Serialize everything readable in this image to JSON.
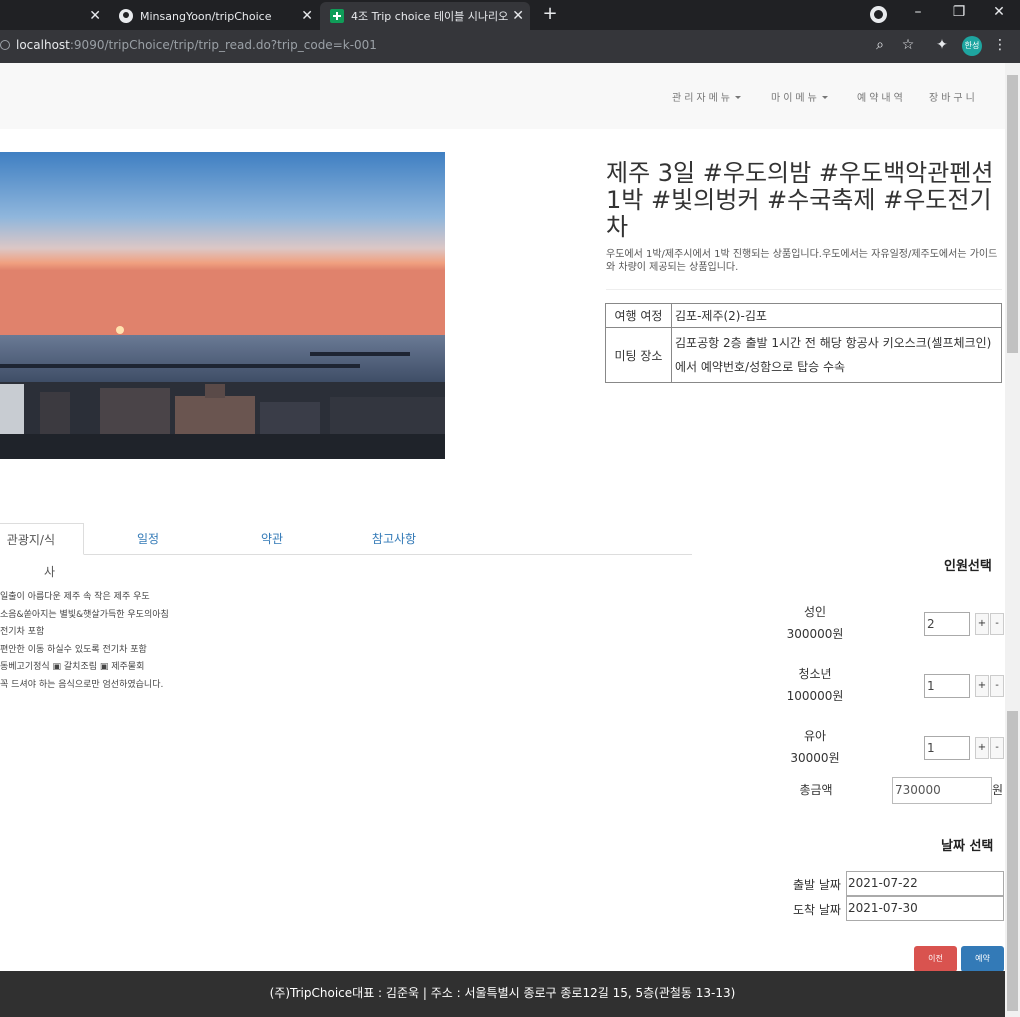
{
  "browser": {
    "tabs": [
      {
        "title": ""
      },
      {
        "title": "MinsangYoon/tripChoice"
      },
      {
        "title": "4조 Trip choice 테이블 시나리오"
      }
    ],
    "new_tab_label": "+",
    "url_host": "localhost",
    "url_rest": ":9090/tripChoice/trip/trip_read.do?trip_code=k-001",
    "avatar_text": "한성"
  },
  "navbar": {
    "items": [
      {
        "label": "관리자메뉴"
      },
      {
        "label": "마이메뉴"
      },
      {
        "label": "예약내역"
      },
      {
        "label": "장바구니"
      }
    ]
  },
  "product": {
    "title": "제주 3일 #우도의밤 #우도백악관펜션1박 #빛의벙커 #수국축제 #우도전기차",
    "description": "우도에서 1박/제주시에서 1박 진행되는 상품입니다.우도에서는 자유일정/제주도에서는 가이드와 차량이 제공되는 상품입니다.",
    "info": [
      {
        "key": "여행 여정",
        "value": "김포-제주(2)-김포"
      },
      {
        "key": "미팅 장소",
        "value": "김포공항 2층 출발 1시간 전 해당 항공사 키오스크(셀프체크인)에서 예약번호/성함으로 탑승 수속"
      }
    ]
  },
  "detail_tabs": [
    {
      "label": "관광지/식사"
    },
    {
      "label": "일정"
    },
    {
      "label": "약관"
    },
    {
      "label": "참고사항"
    }
  ],
  "tab_content": [
    "일출이 아름다운 제주 속 작은 제주 우도",
    "소음&쏟아지는 별빛&햇살가득한 우도의아침",
    "전기차 포함",
    "편안한 이동 하실수 있도록 전기차 포함",
    "동베고기정식 ▣ 갈치조림 ▣ 제주물회",
    "꼭 드셔야 하는 음식으로만 엄선하였습니다."
  ],
  "booking": {
    "people_heading": "인원선택",
    "people": [
      {
        "label": "성인",
        "price": "300000원",
        "qty": "2"
      },
      {
        "label": "청소년",
        "price": "100000원",
        "qty": "1"
      },
      {
        "label": "유아",
        "price": "30000원",
        "qty": "1"
      }
    ],
    "plus": "+",
    "minus": "-",
    "total_label": "총금액",
    "total_value": "730000",
    "total_unit": "원",
    "date_heading": "날짜 선택",
    "depart_label": "출발 날짜",
    "depart_value": "2021-07-22",
    "arrive_label": "도착 날짜",
    "arrive_value": "2021-07-30",
    "prev_button": "이전",
    "reserve_button": "예약"
  },
  "footer": {
    "text": "(주)TripChoice대표 : 김준욱 | 주소 : 서울특별시 종로구 종로12길 15, 5층(관철동 13-13)"
  }
}
